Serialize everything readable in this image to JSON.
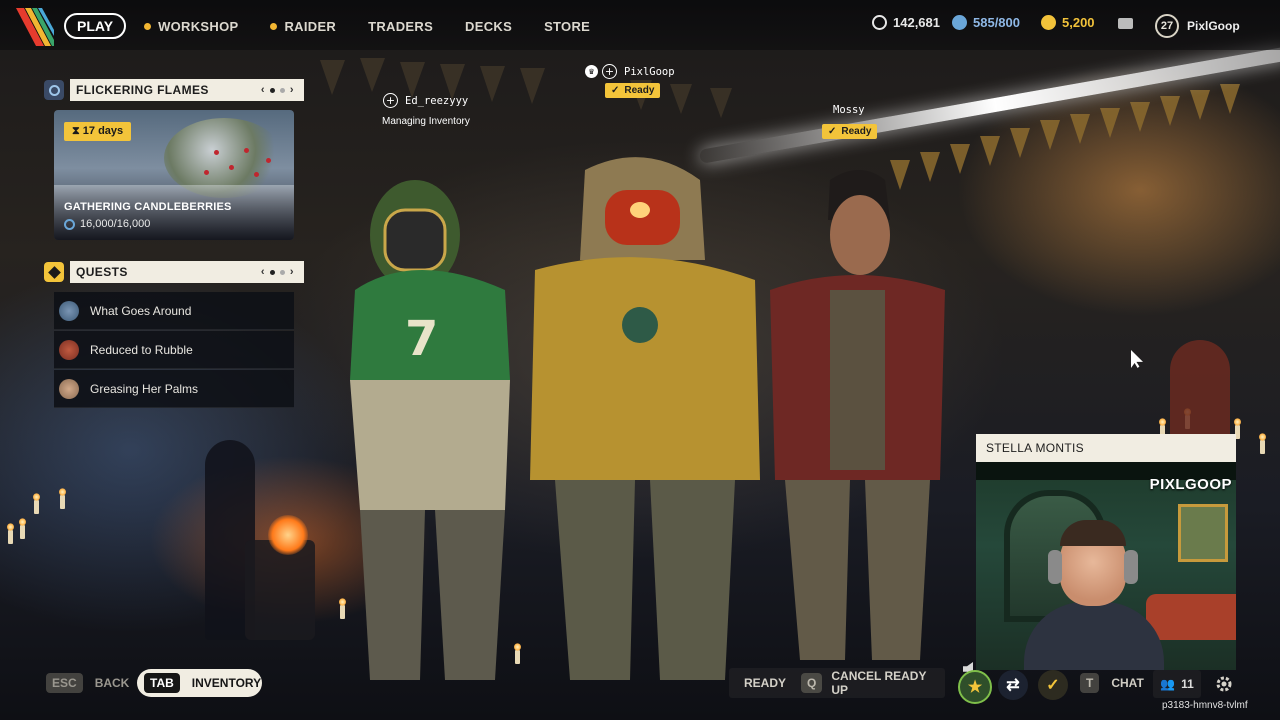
{
  "topbar": {
    "play_label": "PLAY",
    "nav": [
      {
        "label": "WORKSHOP",
        "dot": true
      },
      {
        "label": "RAIDER",
        "dot": true
      },
      {
        "label": "TRADERS",
        "dot": false
      },
      {
        "label": "DECKS",
        "dot": false
      },
      {
        "label": "STORE",
        "dot": false
      }
    ],
    "currencies": [
      {
        "icon": "coin-icon",
        "value": "142,681",
        "color": "#e8e8e8"
      },
      {
        "icon": "credit-icon",
        "value": "585/800",
        "color": "#8fb8e6"
      },
      {
        "icon": "gold-icon",
        "value": "5,200",
        "color": "#f2c23a"
      }
    ],
    "player_level": "27",
    "username": "PixlGoop"
  },
  "event": {
    "title": "FLICKERING FLAMES",
    "days": "17 days",
    "name": "GATHERING CANDLEBERRIES",
    "progress": "16,000/16,000",
    "progress_fraction": 1.0
  },
  "quests": {
    "title": "QUESTS",
    "items": [
      {
        "label": "What Goes Around",
        "avatar_color": "#3d5a77"
      },
      {
        "label": "Reduced to Rubble",
        "avatar_color": "#7a2e22"
      },
      {
        "label": "Greasing Her Palms",
        "avatar_color": "#8a6b52"
      }
    ]
  },
  "party": {
    "leader": {
      "name": "PixlGoop",
      "status": "Ready"
    },
    "member1": {
      "name": "Ed_reezyyy",
      "status": "Managing Inventory"
    },
    "member2": {
      "name": "Mossy",
      "status": "Ready"
    }
  },
  "webcam": {
    "title": "STELLA MONTIS",
    "brand": "PIXLGOOP"
  },
  "bottombar": {
    "back_key": "ESC",
    "back_label": "BACK",
    "inventory_key": "TAB",
    "inventory_label": "INVENTORY",
    "ready_label": "READY",
    "cancel_key": "Q",
    "cancel_label": "CANCEL READY UP",
    "chat_key": "T",
    "chat_label": "CHAT",
    "friends_count": "11"
  },
  "session_id": "p3183-hmnv8-tvlmf",
  "colors": {
    "accent_yellow": "#f3c43a",
    "panel_cream": "#f1ede2",
    "panel_dark": "#0e1016"
  }
}
